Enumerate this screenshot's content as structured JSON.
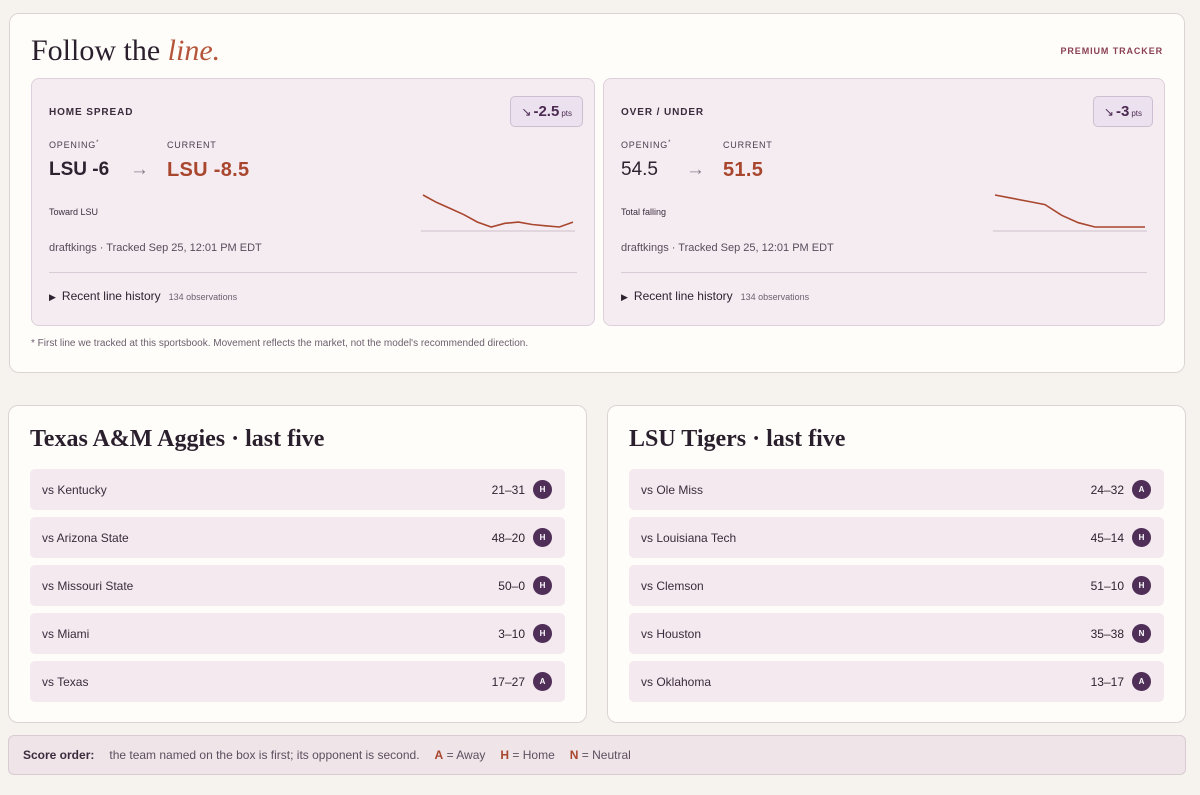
{
  "tracker": {
    "title_main": "Follow the ",
    "title_accent": "line.",
    "badge": "PREMIUM TRACKER",
    "footnote": "* First line we tracked at this sportsbook. Movement reflects the market, not the model's recommended direction.",
    "panels": [
      {
        "label": "HOME SPREAD",
        "movement_arrow": "↘",
        "movement_value": "-2.5",
        "movement_unit": "pts",
        "opening_label": "OPENING",
        "opening_mark": "*",
        "current_label": "CURRENT",
        "opening_value": "LSU -6",
        "arrow": "→",
        "current_value": "LSU -8.5",
        "direction_text": "Toward LSU",
        "tracked_text": "draftkings · Tracked Sep 25, 12:01 PM EDT",
        "history_label": "Recent line history",
        "history_count": "134 observations",
        "spark": [
          -6,
          -6.6,
          -7.1,
          -7.6,
          -8.2,
          -8.6,
          -8.3,
          -8.2,
          -8.4,
          -8.5,
          -8.6,
          -8.2
        ]
      },
      {
        "label": "OVER / UNDER",
        "movement_arrow": "↘",
        "movement_value": "-3",
        "movement_unit": "pts",
        "opening_label": "OPENING",
        "opening_mark": "*",
        "current_label": "CURRENT",
        "opening_value": "54.5",
        "arrow": "→",
        "current_value": "51.5",
        "direction_text": "Total falling",
        "tracked_text": "draftkings · Tracked Sep 25, 12:01 PM EDT",
        "history_label": "Recent line history",
        "history_count": "134 observations",
        "spark": [
          54.5,
          54.2,
          53.9,
          53.6,
          52.6,
          51.9,
          51.5,
          51.5,
          51.5,
          51.5
        ]
      }
    ]
  },
  "teams": [
    {
      "title": "Texas A&M Aggies · last five",
      "games": [
        {
          "opponent": "vs Kentucky",
          "score": "21–31",
          "loc": "H"
        },
        {
          "opponent": "vs Arizona State",
          "score": "48–20",
          "loc": "H"
        },
        {
          "opponent": "vs Missouri State",
          "score": "50–0",
          "loc": "H"
        },
        {
          "opponent": "vs Miami",
          "score": "3–10",
          "loc": "H"
        },
        {
          "opponent": "vs Texas",
          "score": "17–27",
          "loc": "A"
        }
      ]
    },
    {
      "title": "LSU Tigers · last five",
      "games": [
        {
          "opponent": "vs Ole Miss",
          "score": "24–32",
          "loc": "A"
        },
        {
          "opponent": "vs Louisiana Tech",
          "score": "45–14",
          "loc": "H"
        },
        {
          "opponent": "vs Clemson",
          "score": "51–10",
          "loc": "H"
        },
        {
          "opponent": "vs Houston",
          "score": "35–38",
          "loc": "N"
        },
        {
          "opponent": "vs Oklahoma",
          "score": "13–17",
          "loc": "A"
        }
      ]
    }
  ],
  "legend": {
    "label": "Score order:",
    "text": "the team named on the box is first; its opponent is second.",
    "a_key": "A",
    "a_text": "= Away",
    "h_key": "H",
    "h_text": "= Home",
    "n_key": "N",
    "n_text": "= Neutral"
  },
  "colors": {
    "accent": "#b5553a",
    "spark_line": "#a8462e",
    "badge_circle": "#4f2e58"
  }
}
